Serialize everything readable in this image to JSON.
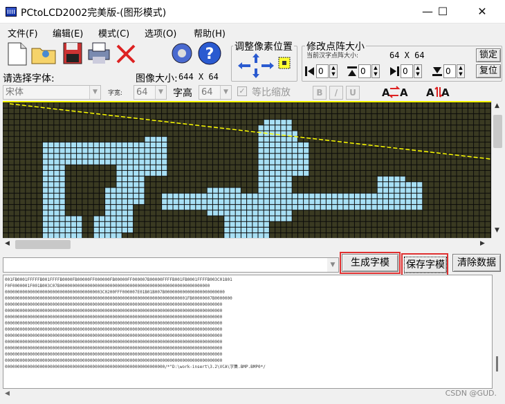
{
  "window": {
    "title": "PCtoLCD2002完美版-(图形模式)",
    "minimize": "—",
    "maximize": "☐",
    "close": "✕"
  },
  "menu": [
    "文件(F)",
    "编辑(E)",
    "模式(C)",
    "选项(O)",
    "帮助(H)"
  ],
  "toolbar": {
    "font_select_label": "请选择字体:",
    "image_size_label": "图像大小:",
    "image_size_value": "644 X 64",
    "adjust_pixel_title": "调整像素位置",
    "modify_matrix_title": "修改点阵大小",
    "current_matrix_label": "当前汉字点阵大小:",
    "current_matrix_value": "64 X 64",
    "lock_button": "锁定",
    "reset_button": "复位",
    "spinners": [
      "0",
      "0",
      "0",
      "0"
    ]
  },
  "font_bar": {
    "font_name": "宋体",
    "width_label": "字宽:",
    "width_value": "64",
    "height_label": "字高",
    "height_value": "64",
    "proportional_label": "等比缩放",
    "bold": "B",
    "italic": "/",
    "underline": "U"
  },
  "actions": {
    "generate_button": "生成字模",
    "save_button": "保存字模",
    "clear_button": "清除数据"
  },
  "output_lines": [
    "001FB0001FFFFFB001FFFFB0000FB00000FF000000FB00000FF000007B00000FFFFB001FB0001FFFFB003C01801",
    "F0F0000001F001B003C07B000000000000000000000000000000000000000000000000000000000000",
    "000000000000000000000000000000000000003C0200FFF000007E01B01B007B000000000000000000000000",
    "0000000000000000000000000000000000000000000000000000000000000000000000001FB00000007B0000000",
    "000000000000000000000000000000000000000000000000000000000000000000000000000000000000000",
    "000000000000000000000000000000000000000000000000000000000000000000000000000000000000000",
    "000000000000000000000000000000000000000000000000000000000000000000000000000000000000000",
    "000000000000000000000000000000000000000000000000000000000000000000000000000000000000000",
    "000000000000000000000000000000000000000000000000000000000000000000000000000000000000000",
    "000000000000000000000000000000000000000000000000000000000000000000000000000000000000000",
    "000000000000000000000000000000000000000000000000000000000000000000000000000000000000000",
    "000000000000000000000000000000000000000000000000000000000000000000000000000000000000000",
    "000000000000000000000000000000000000000000000000000000000000000000000000000000000000000",
    "000000000000000000000000000000000000000000000000000000000000000000000000000000000000000",
    "0000000000000000000000000000000000000000000000000000000000000000/*\"D:\\work-insert\\3.2\\VCA\\字集.BMP.BMP0*/"
  ],
  "watermark": "CSDN @GUD.",
  "colors": {
    "canvas_bg": "#3a3a22",
    "pixel_on": "#a8e0f5",
    "grid_line": "#0a0a0a",
    "top_line": "#ffff00",
    "highlight": "#e03030"
  }
}
